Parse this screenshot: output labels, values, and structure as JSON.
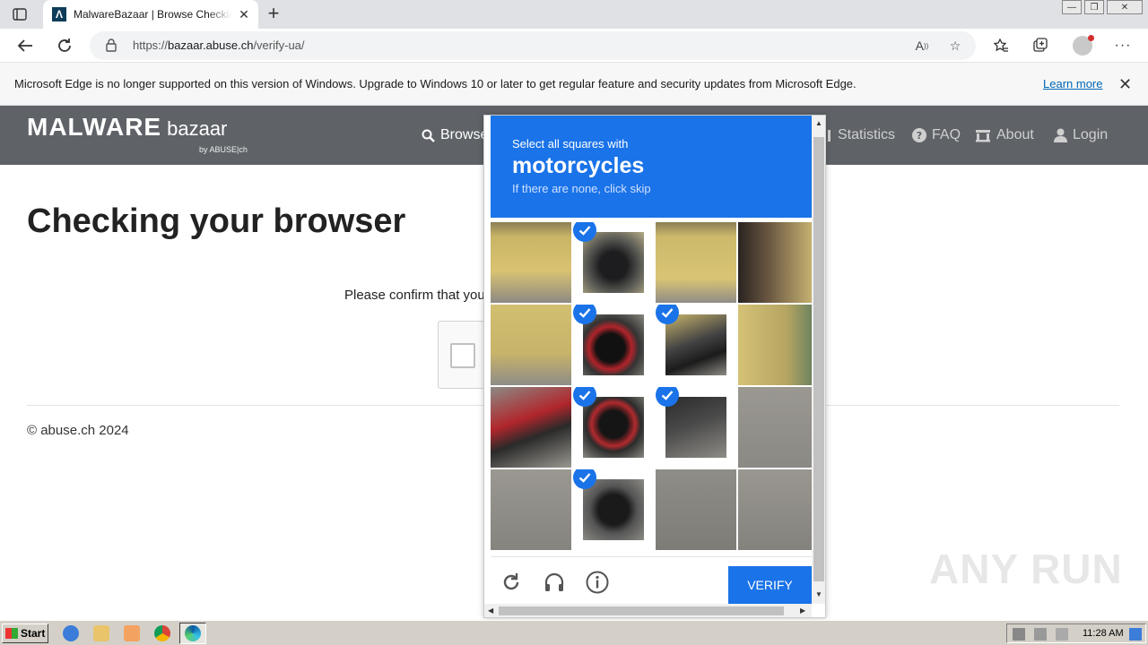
{
  "browser": {
    "tab_title": "MalwareBazaar | Browse Checking your browser",
    "url_prefix": "https://",
    "url_domain": "bazaar.abuse.ch",
    "url_path": "/verify-ua/"
  },
  "infobar": {
    "message": "Microsoft Edge is no longer supported on this version of Windows. Upgrade to Windows 10 or later to get regular feature and security updates from Microsoft Edge.",
    "link": "Learn more"
  },
  "site": {
    "logo_main": "MALWARE",
    "logo_sub": "bazaar",
    "logo_by": "by ABUSE|ch",
    "nav": {
      "browse": "Browse",
      "statistics": "Statistics",
      "faq": "FAQ",
      "about": "About",
      "login": "Login"
    }
  },
  "page": {
    "heading": "Checking your browser",
    "confirm_text": "Please confirm that you are human",
    "footer": "© abuse.ch 2024"
  },
  "captcha": {
    "instruction": "Select all squares with",
    "target": "motorcycles",
    "hint": "If there are none, click skip",
    "verify_label": "VERIFY",
    "selected_tiles": [
      1,
      5,
      6,
      9,
      10,
      13
    ]
  },
  "taskbar": {
    "start": "Start",
    "time": "11:28 AM"
  },
  "watermark": "ANY RUN",
  "colors": {
    "captcha_blue": "#1a73e8",
    "site_header": "#5f6368"
  }
}
